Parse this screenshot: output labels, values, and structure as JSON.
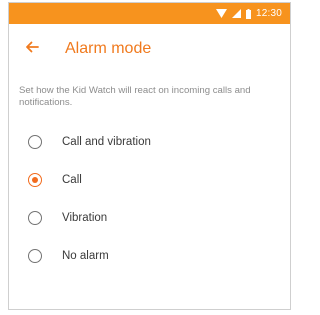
{
  "status_bar": {
    "time": "12:30",
    "background": "#f7931e",
    "icons": [
      "wifi-icon",
      "signal-icon",
      "battery-icon"
    ]
  },
  "app_bar": {
    "title": "Alarm mode",
    "back_icon": "arrow-left-icon",
    "accent": "#f07a1e"
  },
  "description": "Set how the Kid Watch will react on incoming calls and notifications.",
  "options": [
    {
      "label": "Call and vibration",
      "checked": false
    },
    {
      "label": "Call",
      "checked": true
    },
    {
      "label": "Vibration",
      "checked": false
    },
    {
      "label": "No alarm",
      "checked": false
    }
  ]
}
